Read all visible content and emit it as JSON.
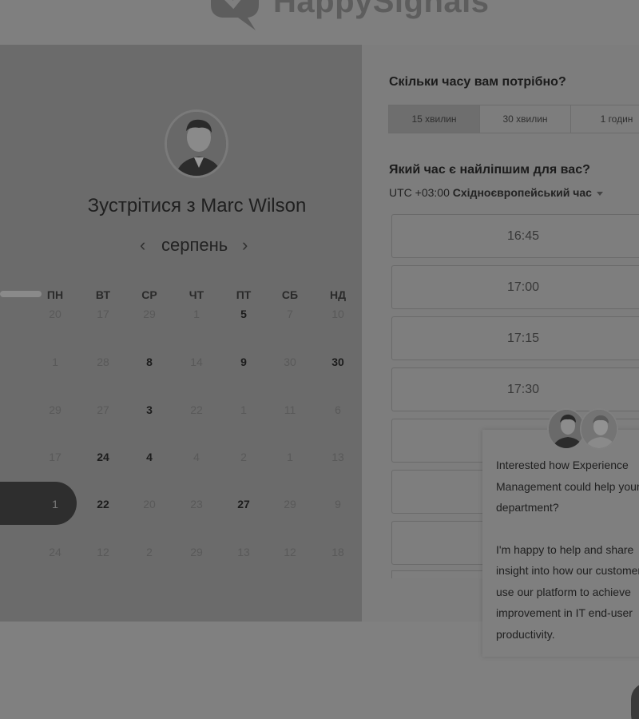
{
  "brand": {
    "logo_text": "HappySignals"
  },
  "meeting": {
    "title": "Зустрітися з Marc Wilson"
  },
  "calendar": {
    "month": "серпень",
    "weekdays": [
      "ПН",
      "ВТ",
      "СР",
      "ЧТ",
      "ПТ",
      "СБ",
      "НД"
    ],
    "selected_day": "1",
    "rows": [
      [
        "20",
        "17",
        "29",
        "1",
        "5",
        "7",
        "10"
      ],
      [
        "1",
        "28",
        "8",
        "14",
        "9",
        "30",
        "30"
      ],
      [
        "29",
        "27",
        "3",
        "22",
        "1",
        "11",
        "6"
      ],
      [
        "17",
        "24",
        "4",
        "4",
        "2",
        "1",
        "13"
      ],
      [
        "1",
        "22",
        "20",
        "23",
        "27",
        "29",
        "9"
      ],
      [
        "24",
        "12",
        "2",
        "29",
        "13",
        "12",
        "18"
      ]
    ],
    "available": [
      [
        false,
        false,
        false,
        false,
        true,
        false,
        false
      ],
      [
        false,
        false,
        true,
        false,
        true,
        false,
        true
      ],
      [
        false,
        false,
        true,
        false,
        false,
        false,
        false
      ],
      [
        false,
        true,
        true,
        false,
        false,
        false,
        false
      ],
      [
        true,
        true,
        false,
        false,
        true,
        false,
        false
      ],
      [
        false,
        false,
        false,
        false,
        false,
        false,
        false
      ]
    ]
  },
  "duration": {
    "question": "Скільки часу вам потрібно?",
    "options": [
      "15 хвилин",
      "30 хвилин",
      "1 годин"
    ],
    "selected": "15 хвилин"
  },
  "time": {
    "question": "Який час є найліпшим для вас?",
    "tz_offset": "UTC +03:00",
    "tz_name": "Східноєвропейський час",
    "slots": [
      "16:45",
      "17:00",
      "17:15",
      "17:30"
    ]
  },
  "chat": {
    "message_1": "Interested how Experience Management could help your department?",
    "message_2": "I'm happy to help and share insight into how our customers use our platform to achieve improvement in IT end-user productivity."
  }
}
